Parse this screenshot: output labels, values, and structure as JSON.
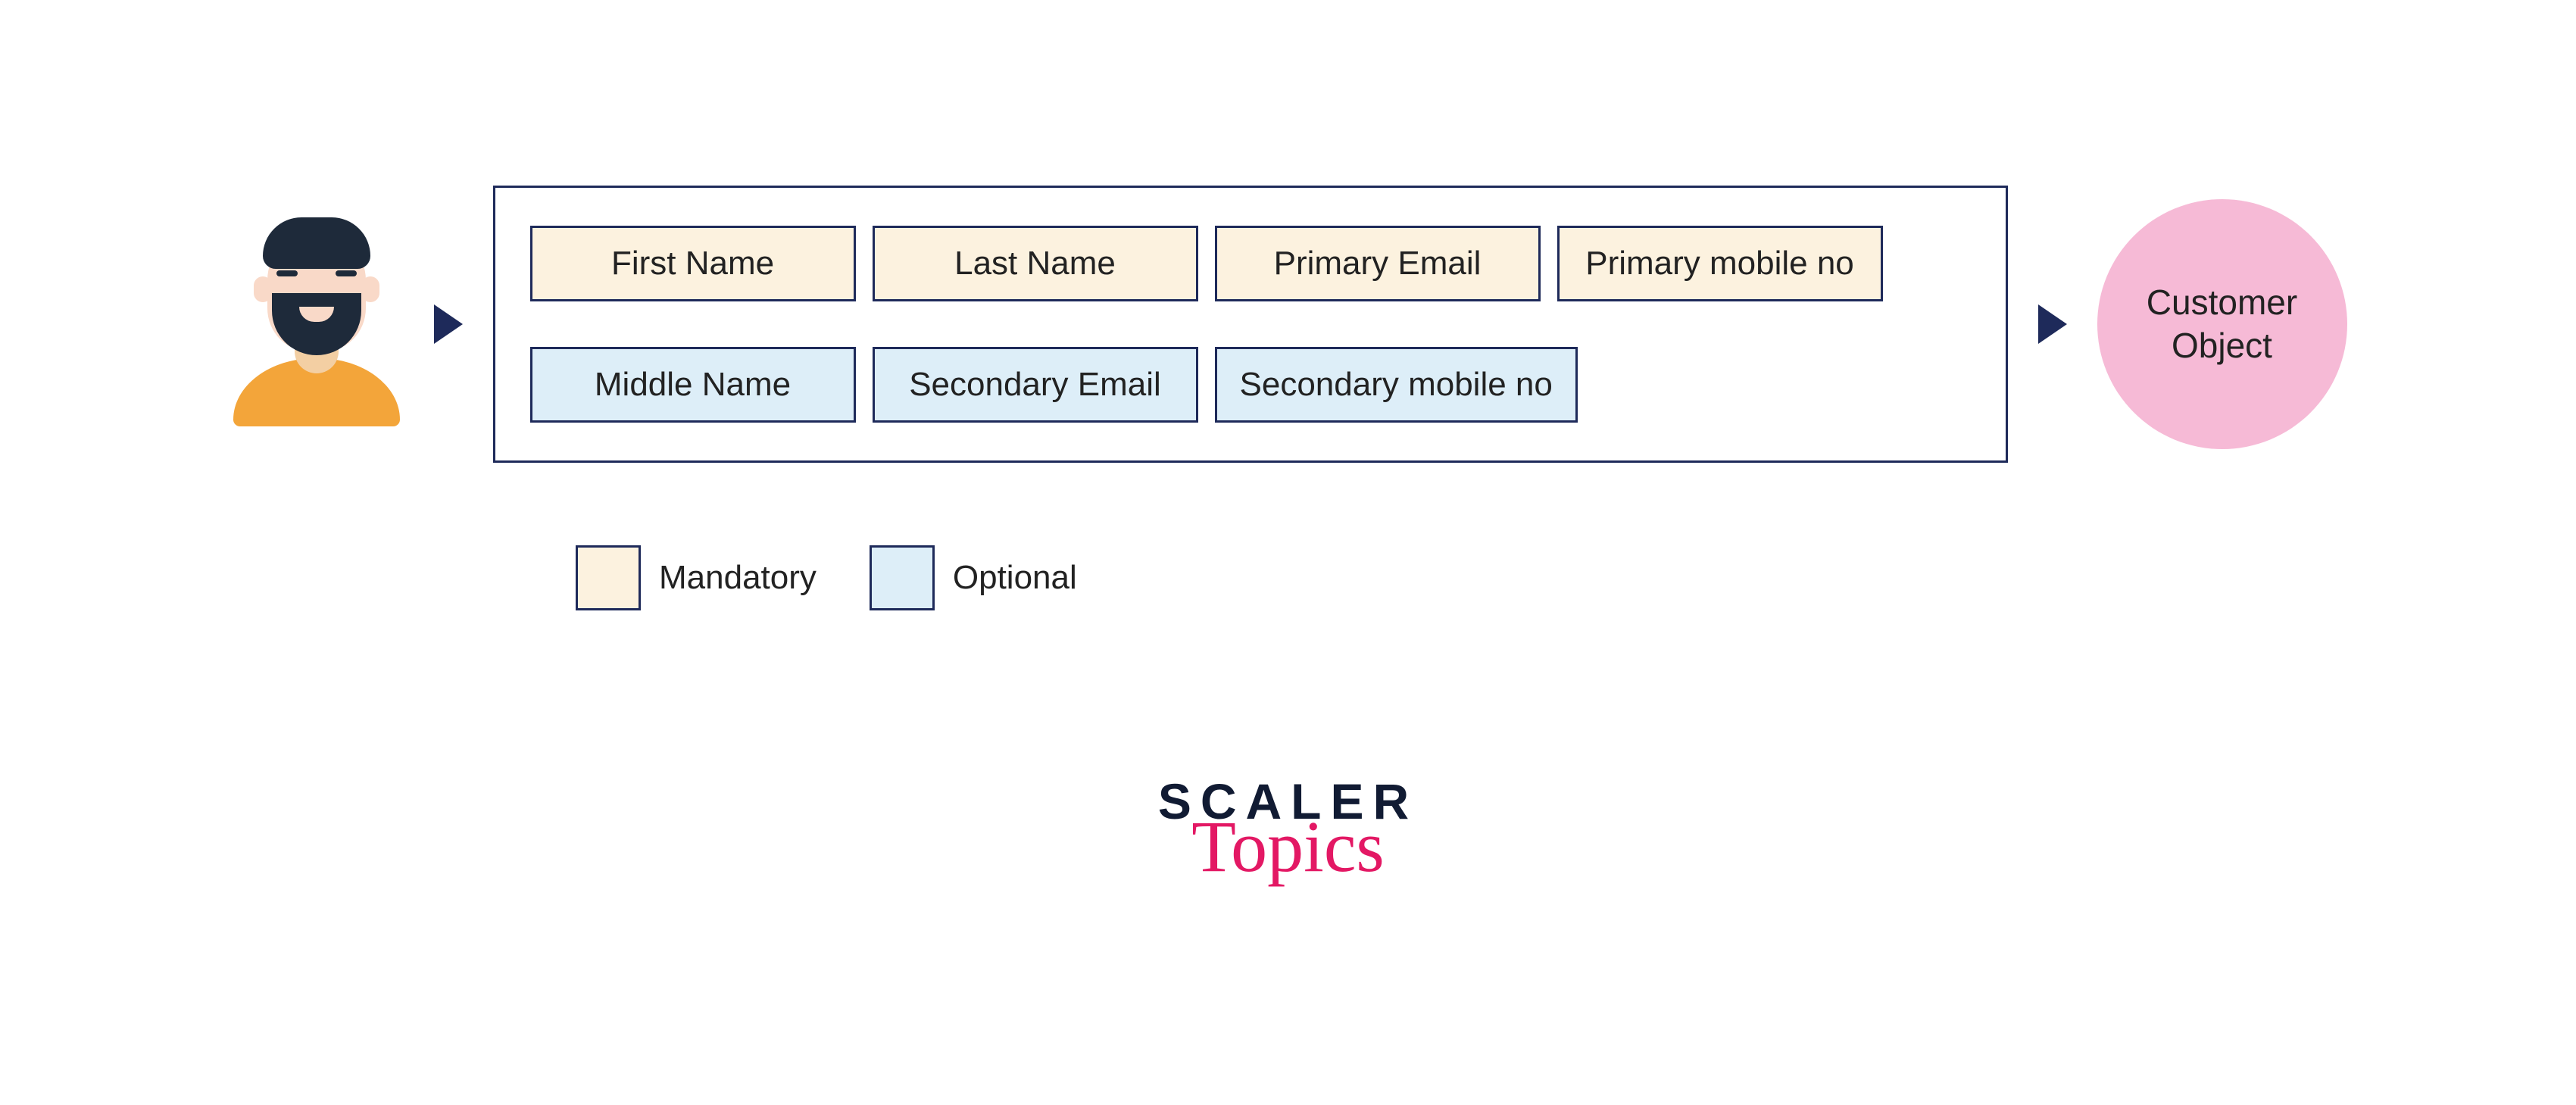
{
  "builder": {
    "mandatory": [
      {
        "label": "First Name"
      },
      {
        "label": "Last Name"
      },
      {
        "label": "Primary Email"
      },
      {
        "label": "Primary mobile no"
      }
    ],
    "optional": [
      {
        "label": "Middle Name"
      },
      {
        "label": "Secondary Email"
      },
      {
        "label": "Secondary mobile no"
      }
    ]
  },
  "legend": {
    "mandatory": "Mandatory",
    "optional": "Optional"
  },
  "output": {
    "label": "Customer\nObject"
  },
  "brand": {
    "line1": "SCALER",
    "line2": "Topics"
  }
}
